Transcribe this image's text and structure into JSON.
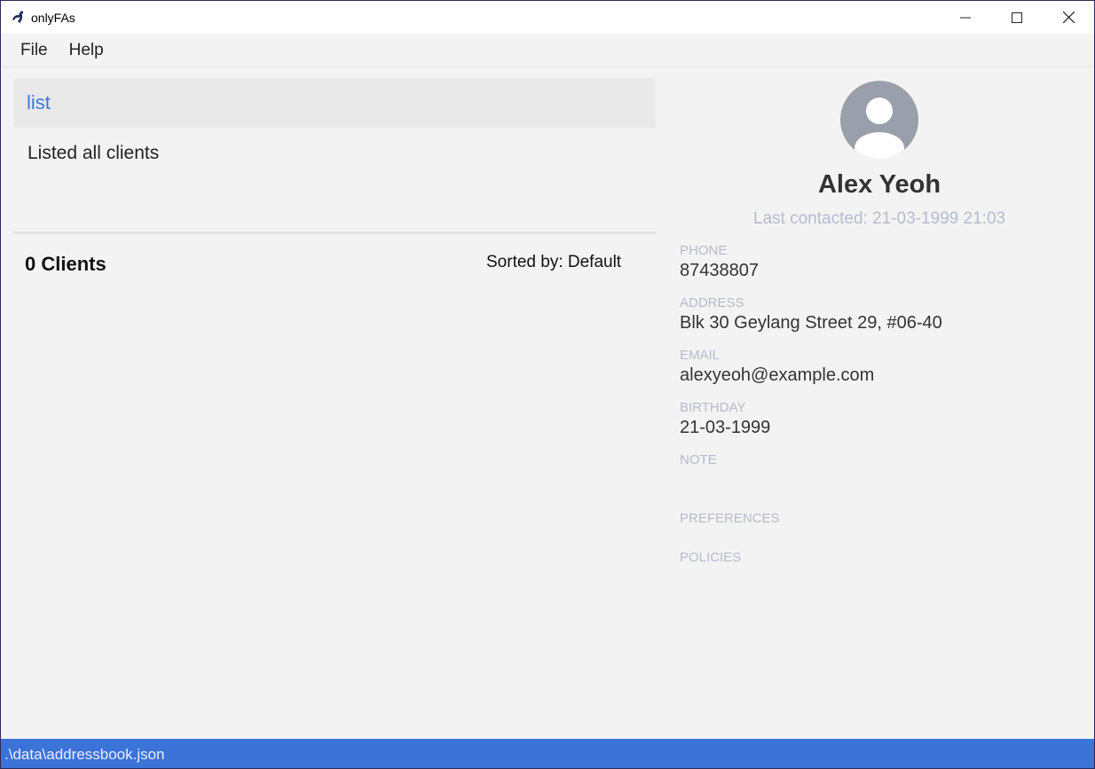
{
  "window": {
    "title": "onlyFAs",
    "controls": [
      "minimize-icon",
      "maximize-icon",
      "close-icon"
    ]
  },
  "menu": {
    "items": [
      {
        "label": "File"
      },
      {
        "label": "Help"
      }
    ]
  },
  "command": {
    "value": "list"
  },
  "result": {
    "message": "Listed all clients"
  },
  "client_list": {
    "count_label": "0 Clients",
    "sorted_by": "Sorted by: Default"
  },
  "person": {
    "name": "Alex Yeoh",
    "last_contacted": "Last contacted: 21-03-1999 21:03",
    "fields": {
      "phone": {
        "label": "PHONE",
        "value": "87438807"
      },
      "address": {
        "label": "ADDRESS",
        "value": "Blk 30 Geylang Street 29, #06-40"
      },
      "email": {
        "label": "EMAIL",
        "value": "alexyeoh@example.com"
      },
      "birthday": {
        "label": "BIRTHDAY",
        "value": "21-03-1999"
      },
      "note": {
        "label": "NOTE",
        "value": ""
      },
      "preferences": {
        "label": "PREFERENCES",
        "value": ""
      },
      "policies": {
        "label": "POLICIES",
        "value": ""
      }
    }
  },
  "status": {
    "file_path": ".\\data\\addressbook.json"
  },
  "colors": {
    "accent": "#3c73d9",
    "command_text": "#3c78d8",
    "muted_label": "#b5bbcc",
    "avatar": "#9aa0ab"
  }
}
